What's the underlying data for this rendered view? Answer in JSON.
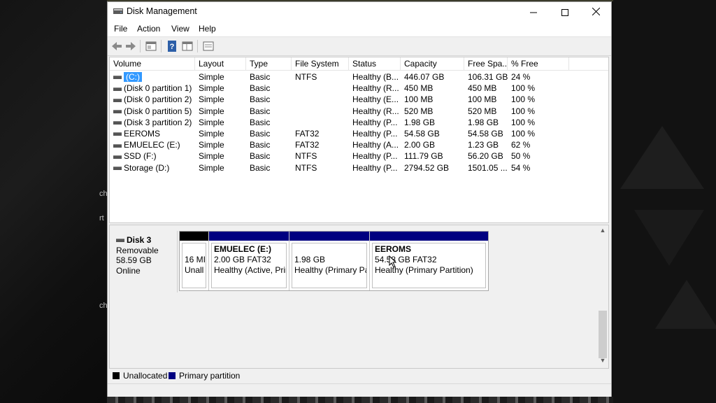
{
  "window": {
    "title": "Disk Management"
  },
  "menu": [
    "File",
    "Action",
    "View",
    "Help"
  ],
  "toolbar": [
    "back-icon",
    "forward-icon",
    "properties-icon",
    "help-icon",
    "volume-list-icon",
    "disk-view-icon"
  ],
  "columns": [
    "Volume",
    "Layout",
    "Type",
    "File System",
    "Status",
    "Capacity",
    "Free Spa...",
    "% Free"
  ],
  "volumes": [
    {
      "volume": "(C:)",
      "layout": "Simple",
      "type": "Basic",
      "fs": "NTFS",
      "status": "Healthy (B...",
      "capacity": "446.07 GB",
      "free": "106.31 GB",
      "pct": "24 %"
    },
    {
      "volume": "(Disk 0 partition 1)",
      "layout": "Simple",
      "type": "Basic",
      "fs": "",
      "status": "Healthy (R...",
      "capacity": "450 MB",
      "free": "450 MB",
      "pct": "100 %"
    },
    {
      "volume": "(Disk 0 partition 2)",
      "layout": "Simple",
      "type": "Basic",
      "fs": "",
      "status": "Healthy (E...",
      "capacity": "100 MB",
      "free": "100 MB",
      "pct": "100 %"
    },
    {
      "volume": "(Disk 0 partition 5)",
      "layout": "Simple",
      "type": "Basic",
      "fs": "",
      "status": "Healthy (R...",
      "capacity": "520 MB",
      "free": "520 MB",
      "pct": "100 %"
    },
    {
      "volume": "(Disk 3 partition 2)",
      "layout": "Simple",
      "type": "Basic",
      "fs": "",
      "status": "Healthy (P...",
      "capacity": "1.98 GB",
      "free": "1.98 GB",
      "pct": "100 %"
    },
    {
      "volume": "EEROMS",
      "layout": "Simple",
      "type": "Basic",
      "fs": "FAT32",
      "status": "Healthy (P...",
      "capacity": "54.58 GB",
      "free": "54.58 GB",
      "pct": "100 %"
    },
    {
      "volume": "EMUELEC (E:)",
      "layout": "Simple",
      "type": "Basic",
      "fs": "FAT32",
      "status": "Healthy (A...",
      "capacity": "2.00 GB",
      "free": "1.23 GB",
      "pct": "62 %"
    },
    {
      "volume": "SSD (F:)",
      "layout": "Simple",
      "type": "Basic",
      "fs": "NTFS",
      "status": "Healthy (P...",
      "capacity": "111.79 GB",
      "free": "56.20 GB",
      "pct": "50 %"
    },
    {
      "volume": "Storage (D:)",
      "layout": "Simple",
      "type": "Basic",
      "fs": "NTFS",
      "status": "Healthy (P...",
      "capacity": "2794.52 GB",
      "free": "1501.05 ...",
      "pct": "54 %"
    }
  ],
  "disk": {
    "name": "Disk 3",
    "kind": "Removable",
    "size": "58.59 GB",
    "state": "Online",
    "partitions": [
      {
        "title": "",
        "line1": "16 MI",
        "line2": "Unall",
        "color": "#000000"
      },
      {
        "title": "EMUELEC (E:)",
        "line1": "2.00 GB FAT32",
        "line2": "Healthy (Active, Prir",
        "color": "#000080"
      },
      {
        "title": "",
        "line1": "1.98 GB",
        "line2": "Healthy (Primary Pa",
        "color": "#000080"
      },
      {
        "title": "EEROMS",
        "line1": "54.58 GB FAT32",
        "line2": "Healthy (Primary Partition)",
        "color": "#000080"
      }
    ]
  },
  "legend": [
    {
      "label": "Unallocated",
      "color": "#000000"
    },
    {
      "label": "Primary partition",
      "color": "#000080"
    }
  ],
  "background_fragments": [
    "ch",
    "rt",
    "ch"
  ]
}
